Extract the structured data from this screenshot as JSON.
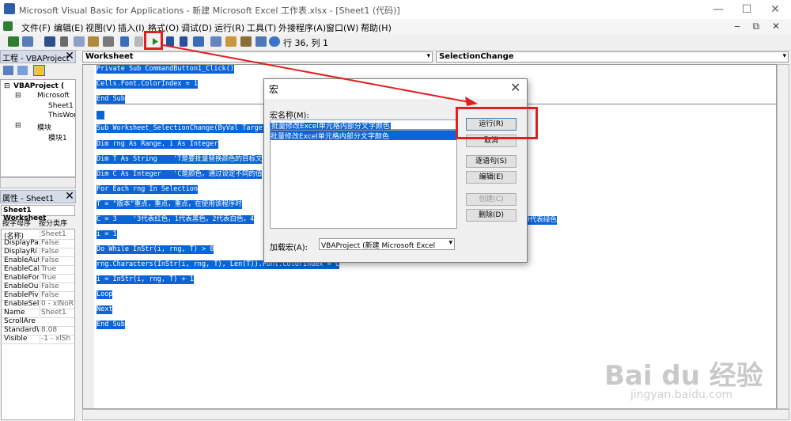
{
  "window": {
    "title": "Microsoft Visual Basic for Applications - 新建 Microsoft Excel 工作表.xlsx - [Sheet1 (代码)]",
    "minimize": "—",
    "maximize": "☐",
    "close": "✕"
  },
  "menu": {
    "items": [
      "文件(F)",
      "编辑(E)",
      "视图(V)",
      "插入(I)",
      "格式(O)",
      "调试(D)",
      "运行(R)",
      "工具(T)",
      "外接程序(A)",
      "窗口(W)",
      "帮助(H)"
    ],
    "right_controls": "‒ ⧉ ✕"
  },
  "toolbar": {
    "position": "行 36, 列 1"
  },
  "project": {
    "title": "工程 - VBAProject",
    "close": "✕",
    "tree": [
      "VBAProject (",
      "Microsoft",
      "Sheet1",
      "ThisWor",
      "模块",
      "模块1"
    ]
  },
  "properties": {
    "title": "属性 - Sheet1",
    "close": "✕",
    "object": "Sheet1 Worksheet",
    "tabs": [
      "按字母序",
      "按分类序"
    ],
    "rows": [
      {
        "name": "(名称)",
        "value": "Sheet1"
      },
      {
        "name": "DisplayPa",
        "value": "False"
      },
      {
        "name": "DisplayRi",
        "value": "False"
      },
      {
        "name": "EnableAut",
        "value": "False"
      },
      {
        "name": "EnableCal",
        "value": "True"
      },
      {
        "name": "EnableFor",
        "value": "True"
      },
      {
        "name": "EnableOut",
        "value": "False"
      },
      {
        "name": "EnablePiv",
        "value": "False"
      },
      {
        "name": "EnableSel",
        "value": "0 - xlNoR"
      },
      {
        "name": "Name",
        "value": "Sheet1"
      },
      {
        "name": "ScrollAre",
        "value": ""
      },
      {
        "name": "StandardW",
        "value": "8.08"
      },
      {
        "name": "Visible",
        "value": "-1 - xlSh"
      }
    ]
  },
  "code": {
    "object_combo": "Worksheet",
    "proc_combo": "SelectionChange",
    "lines": [
      "Private Sub CommandButton1_Click()",
      "Cells.Font.ColorIndex = 1",
      "End Sub",
      "",
      "Sub Worksheet_SelectionChange(ByVal Target As Range)",
      "Dim rng As Range, i As Integer",
      "Dim T As String    'T是要批量替换颜色的目标文",
      "Dim C As Integer   'C是颜色，通过设定不同的值",
      "For Each rng In Selection",
      "T = \"版本\"重点，重点，重点，在使用该程序时",
      "C = 3    '3代表红色，1代表黑色，2代表白色，4",
      "i = 1",
      "Do While InStr(i, rng, T) > 0",
      "rng.Characters(InStr(i, rng, T), Len(T)).Font.ColorIndex = C",
      "i = InStr(i, rng, T) + 1",
      "Loop",
      "Next",
      "End Sub"
    ],
    "line_tail": "，10代表绿色"
  },
  "dialog": {
    "title": "宏",
    "close": "✕",
    "name_label": "宏名称(M):",
    "name_value": "批量修改Excel单元格内部分文字颜色",
    "list_items": [
      "批量修改Excel单元格内部分文字颜色"
    ],
    "buttons": {
      "run": "运行(R)",
      "cancel": "取消",
      "step": "逐语句(S)",
      "edit": "编辑(E)",
      "create": "创建(C)",
      "delete": "删除(D)"
    },
    "macros_in_label": "加载宏(A):",
    "macros_in_value": "VBAProject (新建 Microsoft Excel"
  },
  "watermark": {
    "logo": "Bai du 经验",
    "url": "jingyan.baidu.com"
  },
  "colors": {
    "selection": "#0b64d8",
    "highlight": "#e02020"
  }
}
